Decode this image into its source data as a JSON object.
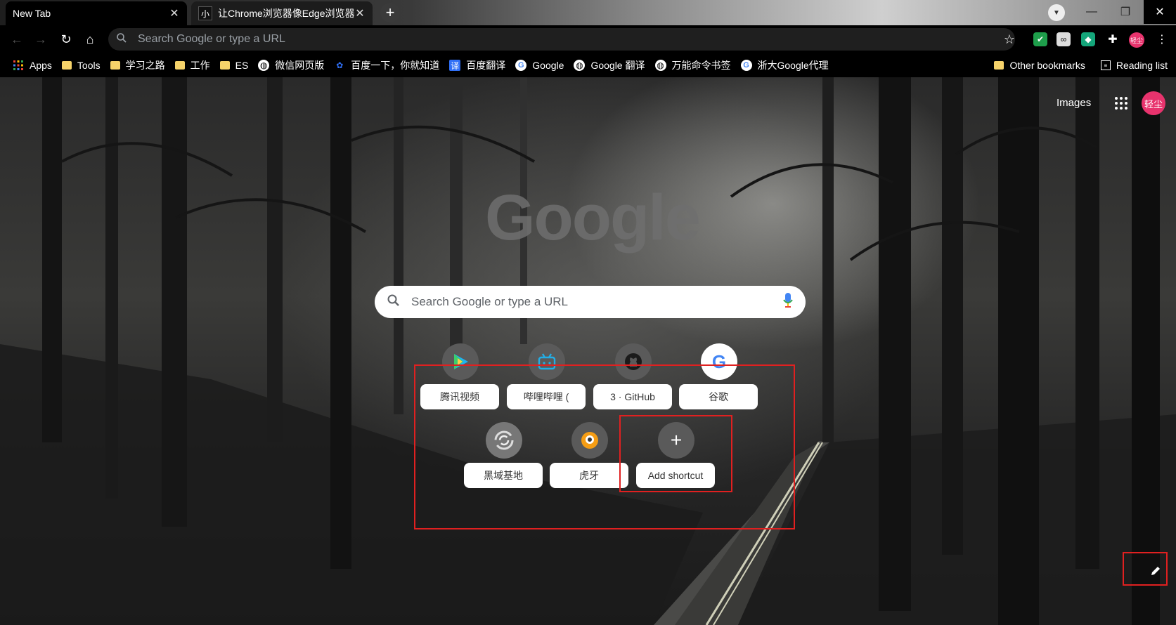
{
  "tabs": [
    {
      "title": "New Tab",
      "active": true
    },
    {
      "title": "让Chrome浏览器像Edge浏览器",
      "active": false,
      "favicon_text": "小"
    }
  ],
  "toolbar": {
    "omnibox_placeholder": "Search Google or type a URL",
    "profile_text": "轻尘"
  },
  "bookmarks": [
    {
      "label": "Apps",
      "icon": "apps-icon"
    },
    {
      "label": "Tools",
      "icon": "folder-icon"
    },
    {
      "label": "学习之路",
      "icon": "folder-icon"
    },
    {
      "label": "工作",
      "icon": "folder-icon"
    },
    {
      "label": "ES",
      "icon": "folder-icon"
    },
    {
      "label": "微信网页版",
      "icon": "globe-icon"
    },
    {
      "label": "百度一下，你就知道",
      "icon": "baidu-icon"
    },
    {
      "label": "百度翻译",
      "icon": "translate-icon",
      "icon_text": "译"
    },
    {
      "label": "Google",
      "icon": "google-icon"
    },
    {
      "label": "Google 翻译",
      "icon": "globe-icon"
    },
    {
      "label": "万能命令书签",
      "icon": "globe-icon"
    },
    {
      "label": "浙大Google代理",
      "icon": "google-icon"
    }
  ],
  "bookmarks_right": {
    "other": "Other bookmarks",
    "reading": "Reading list"
  },
  "ntp": {
    "images_link": "Images",
    "avatar_text": "轻尘",
    "logo": "Google",
    "search_placeholder": "Search Google or type a URL",
    "shortcuts": [
      {
        "label": "腾讯视频",
        "icon": "tencent-video-icon"
      },
      {
        "label": "哔哩哔哩 (",
        "icon": "bilibili-icon"
      },
      {
        "label": "3 · GitHub",
        "icon": "github-icon"
      },
      {
        "label": "谷歌",
        "icon": "google-icon"
      },
      {
        "label": "黑域基地",
        "icon": "swirl-icon"
      },
      {
        "label": "虎牙",
        "icon": "huya-icon"
      },
      {
        "label": "Add shortcut",
        "icon": "plus-icon"
      }
    ]
  },
  "colors": {
    "accent_red": "#e02020",
    "avatar_pink": "#e8336d",
    "folder_yellow": "#f6d36a"
  }
}
